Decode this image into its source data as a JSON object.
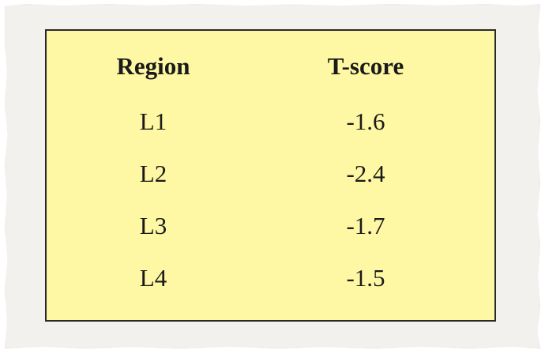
{
  "table": {
    "headers": [
      "Region",
      "T-score"
    ],
    "rows": [
      [
        "L1",
        "-1.6"
      ],
      [
        "L2",
        "-2.4"
      ],
      [
        "L3",
        "-1.7"
      ],
      [
        "L4",
        "-1.5"
      ]
    ]
  },
  "colors": {
    "card_background": "#fef7a3",
    "card_border": "#2a2a2a",
    "paper": "#f3f1ed"
  }
}
